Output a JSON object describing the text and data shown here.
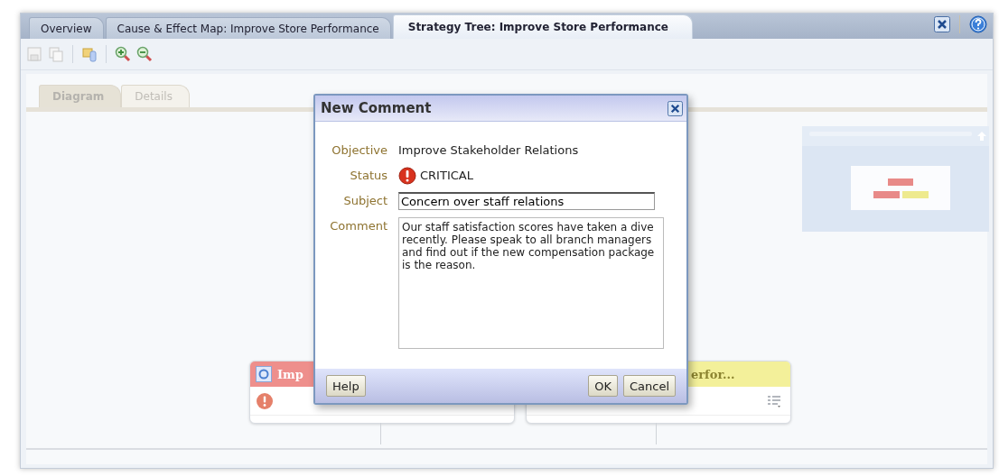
{
  "tabs": [
    {
      "label": "Overview",
      "selected": false
    },
    {
      "label": "Cause & Effect Map: Improve Store Performance",
      "selected": false
    },
    {
      "label": "Strategy Tree: Improve Store Performance",
      "selected": true
    }
  ],
  "subtabs": [
    {
      "label": "Diagram",
      "selected": true
    },
    {
      "label": "Details",
      "selected": false
    }
  ],
  "nodes": [
    {
      "title": "Imp",
      "kind": "critical"
    },
    {
      "title": "erfor...",
      "kind": "warning"
    }
  ],
  "dialog": {
    "title": "New Comment",
    "objective_label": "Objective",
    "objective": "Improve Stakeholder Relations",
    "status_label": "Status",
    "status": "CRITICAL",
    "subject_label": "Subject",
    "subject": "Concern over staff relations",
    "comment_label": "Comment",
    "comment": "Our staff satisfaction scores have taken a dive recently. Please speak to all branch managers and find out if the new compensation package is the reason.",
    "buttons": {
      "help": "Help",
      "ok": "OK",
      "cancel": "Cancel"
    }
  }
}
